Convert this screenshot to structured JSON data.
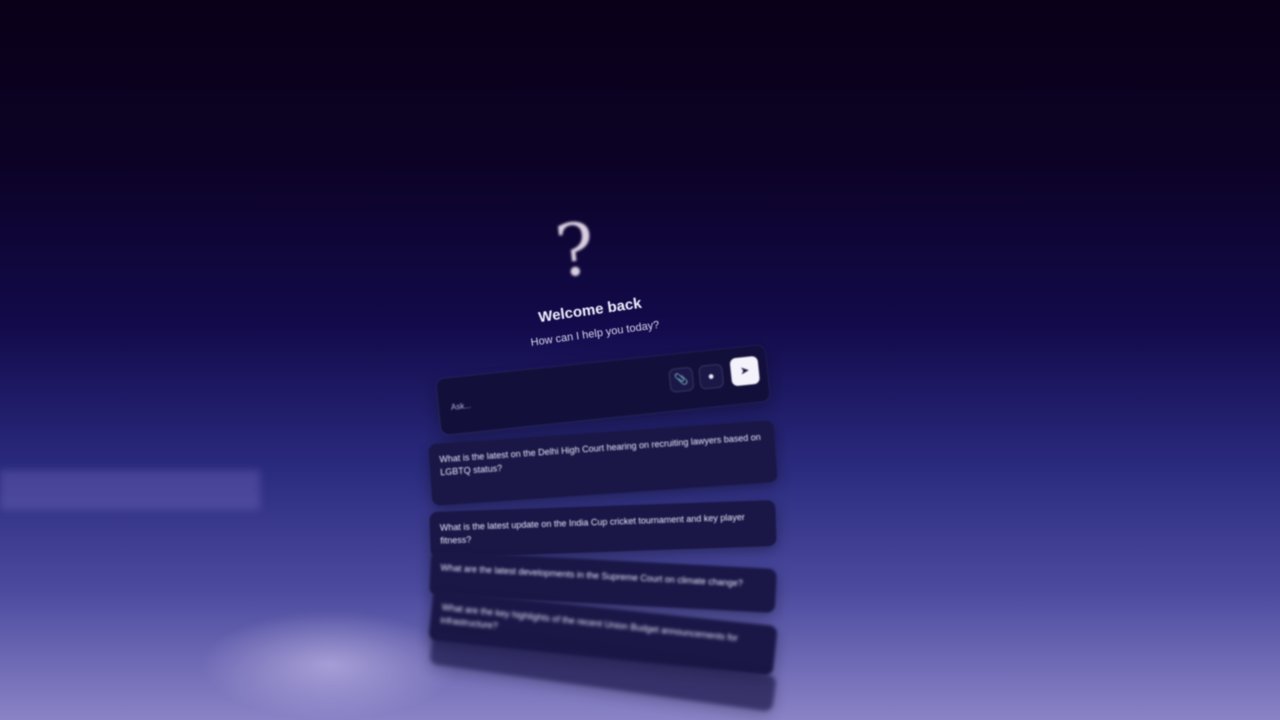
{
  "welcome": {
    "title": "Welcome back",
    "subtitle": "How can I help you today?"
  },
  "composer": {
    "placeholder": "Ask...",
    "attach_icon": "paperclip-icon",
    "mic_icon": "microphone-icon",
    "send_icon": "send-icon"
  },
  "suggestions": [
    {
      "text": "What is the latest on the Delhi High Court hearing on recruiting lawyers based on LGBTQ status?"
    },
    {
      "text": "What is the latest update on the India Cup cricket tournament and key player fitness?"
    },
    {
      "text": "What are the latest developments in the Supreme Court on climate change?"
    },
    {
      "text": "What are the key highlights of the recent Union Budget announcements for infrastructure?"
    },
    {
      "text": ""
    }
  ]
}
